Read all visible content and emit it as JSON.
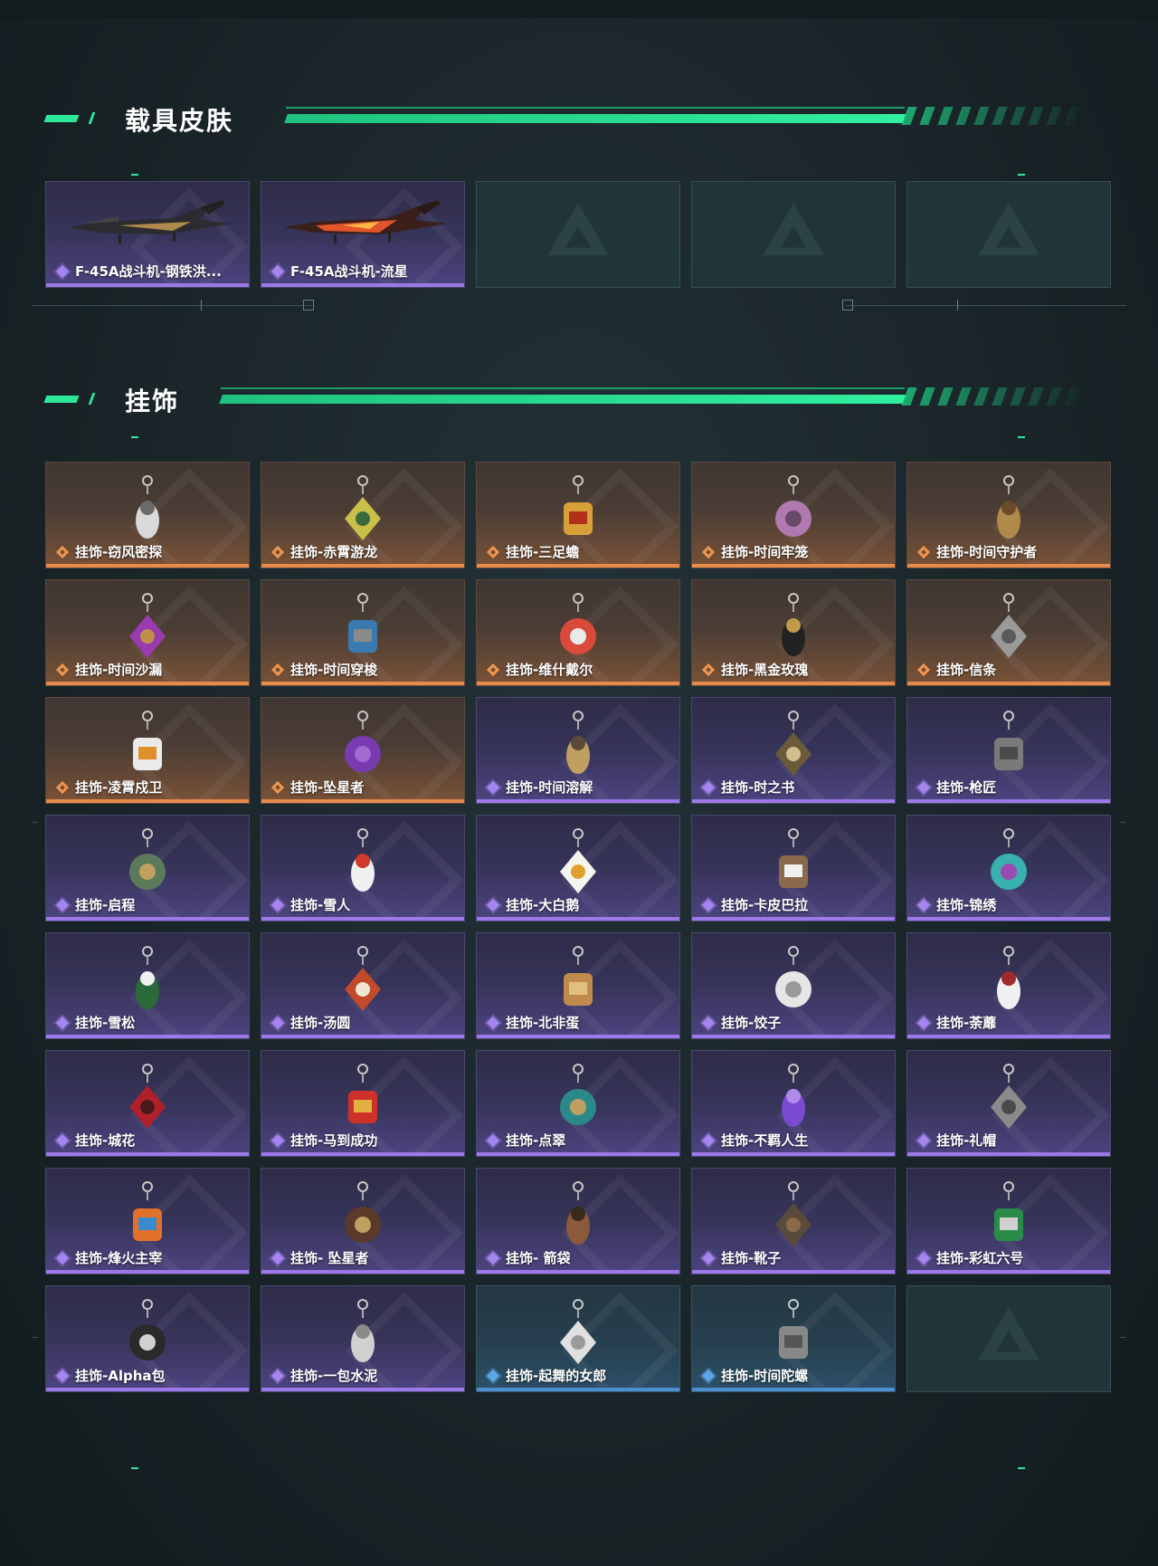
{
  "sections": {
    "vehicle_skins": {
      "title": "载具皮肤",
      "items": [
        {
          "label": "F-45A战斗机-钢铁洪...",
          "rarity": "purple"
        },
        {
          "label": "F-45A战斗机-流星",
          "rarity": "purple"
        }
      ]
    },
    "charms": {
      "title": "挂饰",
      "items": [
        {
          "label": "挂饰-窃风密探",
          "rarity": "orange"
        },
        {
          "label": "挂饰-赤霄游龙",
          "rarity": "orange"
        },
        {
          "label": "挂饰-三足蟾",
          "rarity": "orange"
        },
        {
          "label": "挂饰-时间牢笼",
          "rarity": "orange"
        },
        {
          "label": "挂饰-时间守护者",
          "rarity": "orange"
        },
        {
          "label": "挂饰-时间沙漏",
          "rarity": "orange"
        },
        {
          "label": "挂饰-时间穿梭",
          "rarity": "orange"
        },
        {
          "label": "挂饰-维什戴尔",
          "rarity": "orange"
        },
        {
          "label": "挂饰-黑金玫瑰",
          "rarity": "orange"
        },
        {
          "label": "挂饰-信条",
          "rarity": "orange"
        },
        {
          "label": "挂饰-凌霄戍卫",
          "rarity": "orange"
        },
        {
          "label": "挂饰-坠星者",
          "rarity": "orange"
        },
        {
          "label": "挂饰-时间溶解",
          "rarity": "purple"
        },
        {
          "label": "挂饰-时之书",
          "rarity": "purple"
        },
        {
          "label": "挂饰-枪匠",
          "rarity": "purple"
        },
        {
          "label": "挂饰-启程",
          "rarity": "purple"
        },
        {
          "label": "挂饰-雪人",
          "rarity": "purple"
        },
        {
          "label": "挂饰-大白鹅",
          "rarity": "purple"
        },
        {
          "label": "挂饰-卡皮巴拉",
          "rarity": "purple"
        },
        {
          "label": "挂饰-锦绣",
          "rarity": "purple"
        },
        {
          "label": "挂饰-雪松",
          "rarity": "purple"
        },
        {
          "label": "挂饰-汤圆",
          "rarity": "purple"
        },
        {
          "label": "挂饰-北非蛋",
          "rarity": "purple"
        },
        {
          "label": "挂饰-饺子",
          "rarity": "purple"
        },
        {
          "label": "挂饰-荼蘼",
          "rarity": "purple"
        },
        {
          "label": "挂饰-城花",
          "rarity": "purple"
        },
        {
          "label": "挂饰-马到成功",
          "rarity": "purple"
        },
        {
          "label": "挂饰-点翠",
          "rarity": "purple"
        },
        {
          "label": "挂饰-不羁人生",
          "rarity": "purple"
        },
        {
          "label": "挂饰-礼帽",
          "rarity": "purple"
        },
        {
          "label": "挂饰-烽火主宰",
          "rarity": "purple"
        },
        {
          "label": "挂饰- 坠星者",
          "rarity": "purple"
        },
        {
          "label": "挂饰- 箭袋",
          "rarity": "purple"
        },
        {
          "label": "挂饰-靴子",
          "rarity": "purple"
        },
        {
          "label": "挂饰-彩虹六号",
          "rarity": "purple"
        },
        {
          "label": "挂饰-Alpha包",
          "rarity": "purple"
        },
        {
          "label": "挂饰-一包水泥",
          "rarity": "purple"
        },
        {
          "label": "挂饰-起舞的女郎",
          "rarity": "blue"
        },
        {
          "label": "挂饰-时间陀螺",
          "rarity": "blue"
        }
      ]
    }
  },
  "colors": {
    "accent": "#2ee89a",
    "orange_rarity": "#e88a4a",
    "purple_rarity": "#9c78e8",
    "blue_rarity": "#4b8fd0"
  }
}
